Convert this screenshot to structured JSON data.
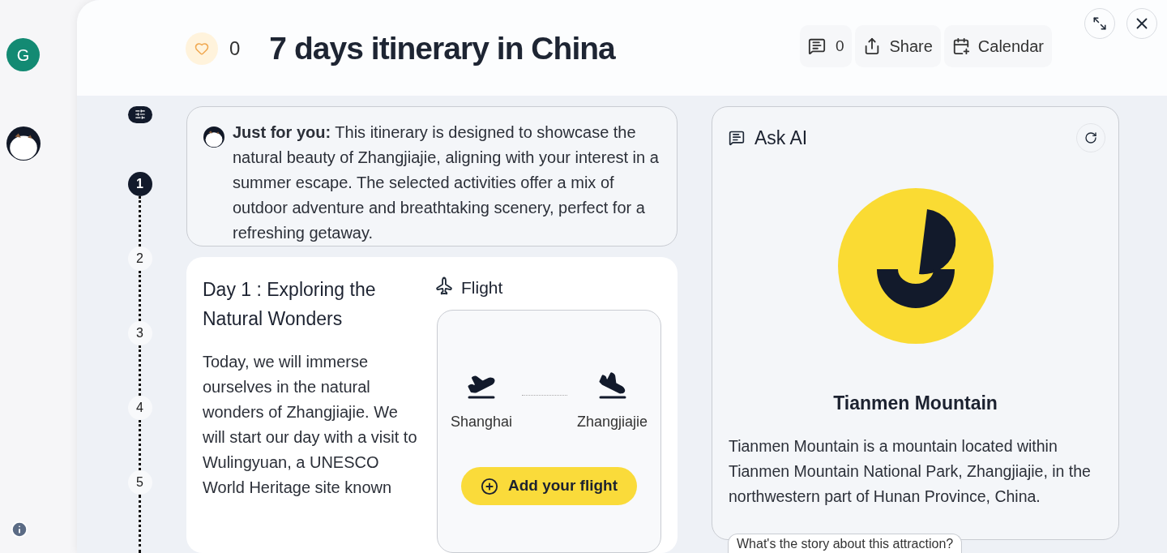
{
  "sidebar": {
    "avatar_letter": "G"
  },
  "header": {
    "likes": "0",
    "title": "7 days itinerary in China",
    "comments": "0",
    "actions": [
      "Share",
      "Calendar"
    ]
  },
  "timeline": {
    "steps": [
      {
        "label": "1",
        "selected": true
      },
      {
        "label": "2",
        "selected": false
      },
      {
        "label": "3",
        "selected": false
      },
      {
        "label": "4",
        "selected": false
      },
      {
        "label": "5",
        "selected": false
      }
    ]
  },
  "intro": {
    "text": "**Just for you:** This itinerary is designed to showcase the natural beauty of Zhangjiajie, aligning with your interest in a summer escape. The selected activities offer a mix of outdoor adventure and breathtaking scenery, perfect for a refreshing getaway."
  },
  "day": {
    "title": "Day 1 : Exploring the Natural Wonders",
    "text": "Today, we will immerse ourselves in the natural wonders of Zhangjiajie. We will start our day with a visit to Wulingyuan, a UNESCO World Heritage site known"
  },
  "flight": {
    "heading": "Flight",
    "from": "Shanghai",
    "to": "Zhangjiajie",
    "button": "Add your flight"
  },
  "ask_ai": {
    "title": "Ask AI",
    "place": "Tianmen Mountain",
    "description": "Tianmen Mountain is a mountain located within Tianmen Mountain National Park, Zhangjiajie, in the northwestern part of Hunan Province, China.",
    "suggestion": "What's the story about this attraction?"
  }
}
